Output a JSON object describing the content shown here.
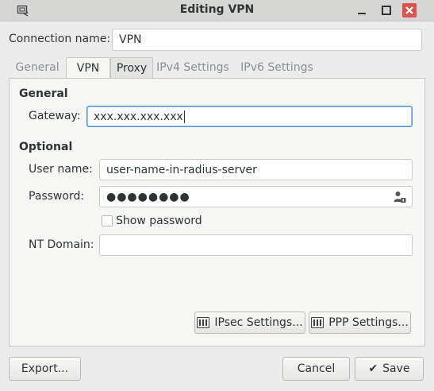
{
  "window": {
    "title": "Editing VPN"
  },
  "connection": {
    "label": "Connection name:",
    "value": "VPN"
  },
  "tabs": [
    {
      "label": "General"
    },
    {
      "label": "VPN"
    },
    {
      "label": "Proxy"
    },
    {
      "label": "IPv4 Settings"
    },
    {
      "label": "IPv6 Settings"
    }
  ],
  "vpn": {
    "general_heading": "General",
    "gateway_label": "Gateway:",
    "gateway_value": "xxx.xxx.xxx.xxx",
    "optional_heading": "Optional",
    "username_label": "User name:",
    "username_value": "user-name-in-radius-server",
    "password_label": "Password:",
    "password_value": "●●●●●●●●",
    "show_password_label": "Show password",
    "nt_domain_label": "NT Domain:",
    "nt_domain_value": "",
    "ipsec_button": "IPsec Settings...",
    "ppp_button": "PPP Settings..."
  },
  "footer": {
    "export": "Export...",
    "cancel": "Cancel",
    "save": "Save"
  },
  "icons": {
    "app": "network-settings-icon",
    "minimize": "minimize-icon",
    "maximize": "maximize-icon",
    "close": "close-icon",
    "password_store": "user-password-icon"
  },
  "colors": {
    "focus_border": "#4a90d9",
    "close_button": "#d9534f"
  }
}
